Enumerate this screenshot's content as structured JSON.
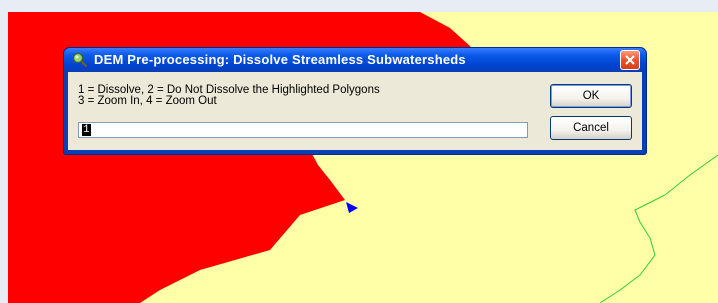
{
  "dialog": {
    "title": "DEM Pre-processing: Dissolve Streamless Subwatersheds",
    "prompt_line1": "1 = Dissolve, 2 = Do Not Dissolve the Highlighted Polygons",
    "prompt_line2": "3 = Zoom In, 4 = Zoom Out",
    "input_value": "1",
    "ok_label": "OK",
    "cancel_label": "Cancel"
  },
  "map": {
    "highlight_color": "#ff0000",
    "background_color": "#ffffa8",
    "stream_color": "#33cc33",
    "pointer_color": "#0000ff"
  }
}
